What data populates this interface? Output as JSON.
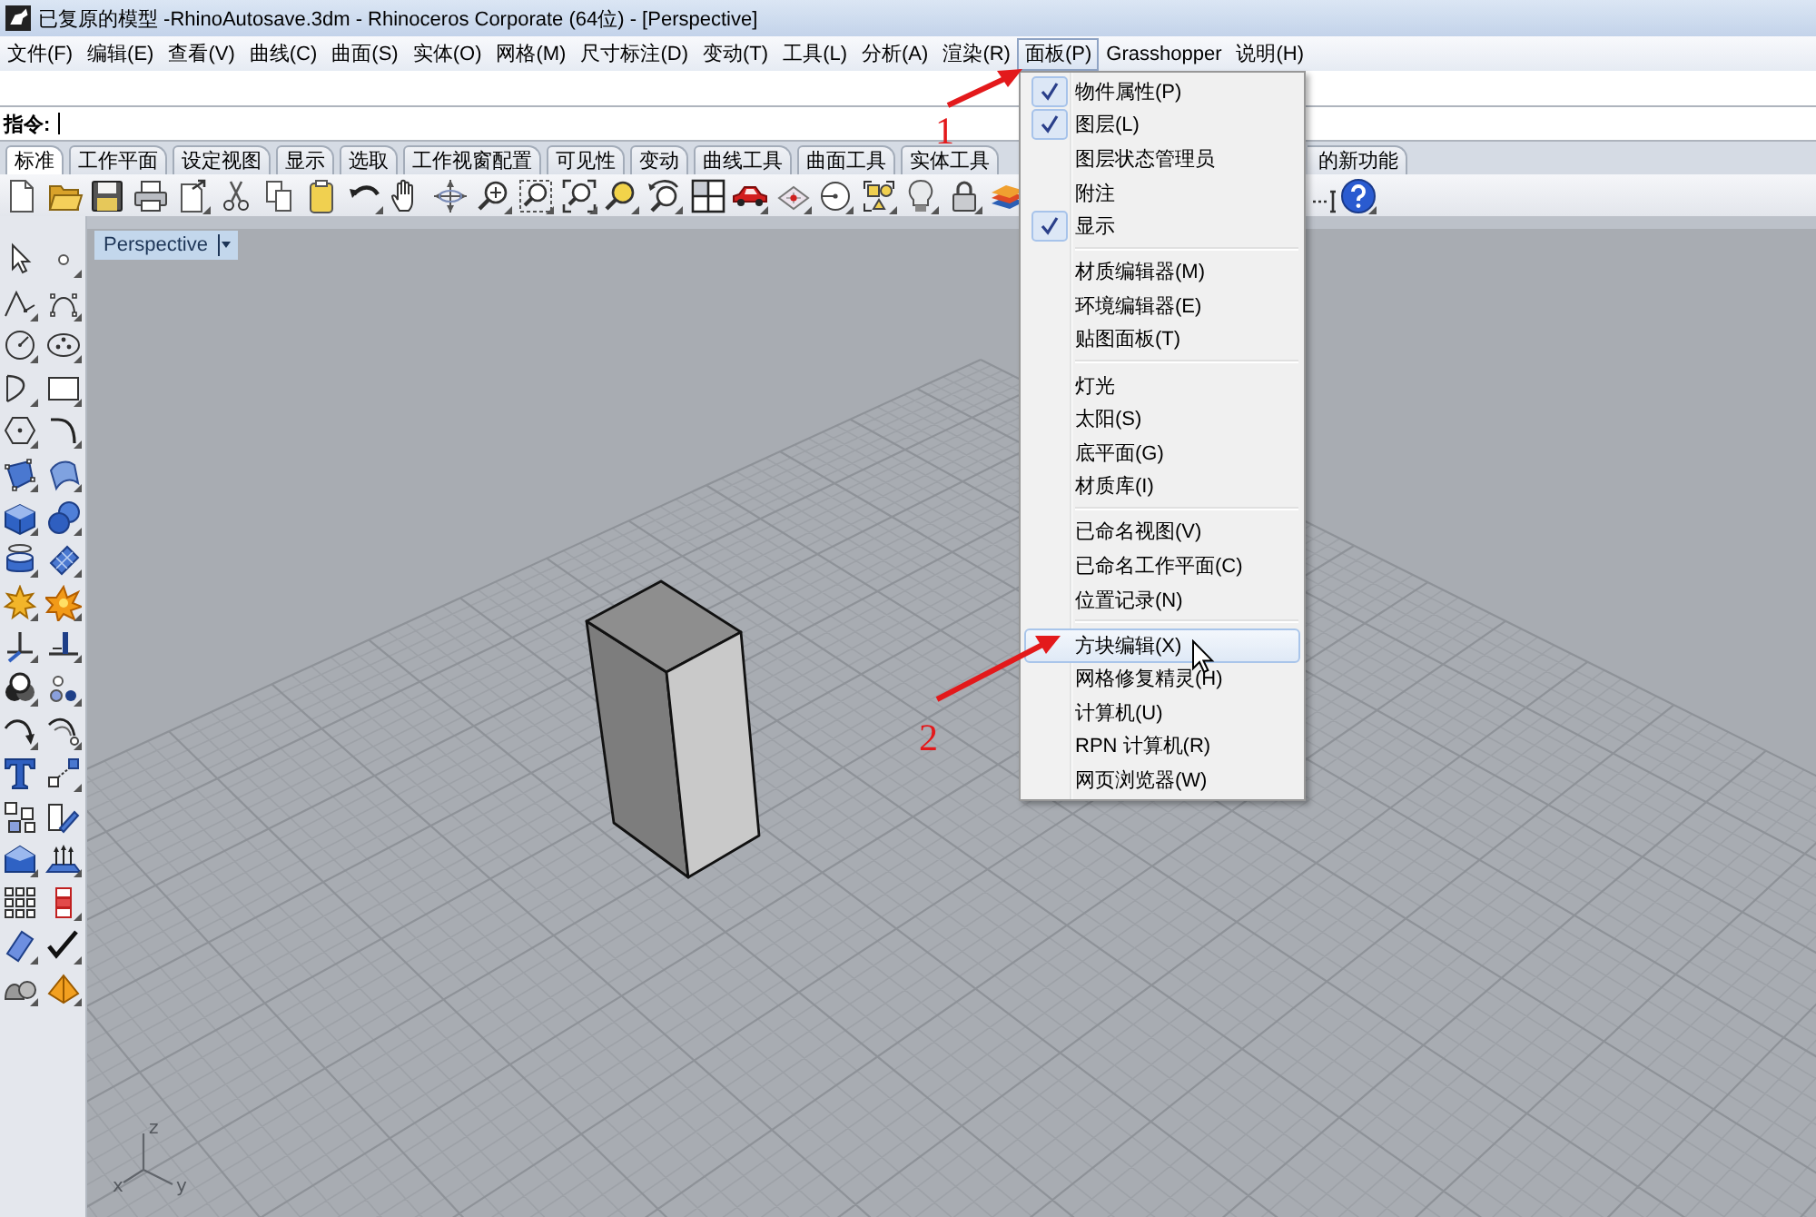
{
  "window": {
    "title": "已复原的模型 -RhinoAutosave.3dm - Rhinoceros Corporate (64位) - [Perspective]"
  },
  "menu_bar": [
    {
      "label": "文件(F)",
      "selected": false
    },
    {
      "label": "编辑(E)",
      "selected": false
    },
    {
      "label": "查看(V)",
      "selected": false
    },
    {
      "label": "曲线(C)",
      "selected": false
    },
    {
      "label": "曲面(S)",
      "selected": false
    },
    {
      "label": "实体(O)",
      "selected": false
    },
    {
      "label": "网格(M)",
      "selected": false
    },
    {
      "label": "尺寸标注(D)",
      "selected": false
    },
    {
      "label": "变动(T)",
      "selected": false
    },
    {
      "label": "工具(L)",
      "selected": false
    },
    {
      "label": "分析(A)",
      "selected": false
    },
    {
      "label": "渲染(R)",
      "selected": false
    },
    {
      "label": "面板(P)",
      "selected": true
    },
    {
      "label": "Grasshopper",
      "selected": false
    },
    {
      "label": "说明(H)",
      "selected": false
    }
  ],
  "command_line": {
    "prompt": "指令:"
  },
  "toolbar_tabs": [
    {
      "kind": "full",
      "label": "标准",
      "selected": true
    },
    {
      "kind": "full",
      "label": "工作平面",
      "selected": false
    },
    {
      "kind": "full",
      "label": "设定视图",
      "selected": false
    },
    {
      "kind": "full",
      "label": "显示",
      "selected": false
    },
    {
      "kind": "full",
      "label": "选取",
      "selected": false
    },
    {
      "kind": "full",
      "label": "工作视窗配置",
      "selected": false
    },
    {
      "kind": "full",
      "label": "可见性",
      "selected": false
    },
    {
      "kind": "full",
      "label": "变动",
      "selected": false
    },
    {
      "kind": "full",
      "label": "曲线工具",
      "selected": false
    },
    {
      "kind": "full",
      "label": "曲面工具",
      "selected": false
    },
    {
      "kind": "full",
      "label": "实体工具",
      "selected": false
    },
    {
      "kind": "partial",
      "label": "的新功能",
      "selected": false
    }
  ],
  "viewport": {
    "title": "Perspective",
    "axis_labels": [
      "z",
      "x",
      "y"
    ]
  },
  "panel_menu": {
    "items": [
      {
        "kind": "item",
        "label": "物件属性(P)",
        "checked": true,
        "selected": false
      },
      {
        "kind": "item",
        "label": "图层(L)",
        "checked": true,
        "selected": false
      },
      {
        "kind": "item",
        "label": "图层状态管理员",
        "checked": false,
        "selected": false
      },
      {
        "kind": "item",
        "label": "附注",
        "checked": false,
        "selected": false
      },
      {
        "kind": "item",
        "label": "显示",
        "checked": true,
        "selected": false
      },
      {
        "kind": "separator"
      },
      {
        "kind": "item",
        "label": "材质编辑器(M)",
        "checked": false,
        "selected": false
      },
      {
        "kind": "item",
        "label": "环境编辑器(E)",
        "checked": false,
        "selected": false
      },
      {
        "kind": "item",
        "label": "贴图面板(T)",
        "checked": false,
        "selected": false
      },
      {
        "kind": "separator"
      },
      {
        "kind": "item",
        "label": "灯光",
        "checked": false,
        "selected": false
      },
      {
        "kind": "item",
        "label": "太阳(S)",
        "checked": false,
        "selected": false
      },
      {
        "kind": "item",
        "label": "底平面(G)",
        "checked": false,
        "selected": false
      },
      {
        "kind": "item",
        "label": "材质库(I)",
        "checked": false,
        "selected": false
      },
      {
        "kind": "separator"
      },
      {
        "kind": "item",
        "label": "已命名视图(V)",
        "checked": false,
        "selected": false
      },
      {
        "kind": "item",
        "label": "已命名工作平面(C)",
        "checked": false,
        "selected": false
      },
      {
        "kind": "item",
        "label": "位置记录(N)",
        "checked": false,
        "selected": false
      },
      {
        "kind": "separator"
      },
      {
        "kind": "item",
        "label": "方块编辑(X)",
        "checked": false,
        "selected": true
      },
      {
        "kind": "item",
        "label": "网格修复精灵(H)",
        "checked": false,
        "selected": false
      },
      {
        "kind": "item",
        "label": "计算机(U)",
        "checked": false,
        "selected": false
      },
      {
        "kind": "item",
        "label": "RPN 计算机(R)",
        "checked": false,
        "selected": false
      },
      {
        "kind": "item",
        "label": "网页浏览器(W)",
        "checked": false,
        "selected": false
      }
    ]
  },
  "annotations": [
    {
      "label": "1"
    },
    {
      "label": "2"
    }
  ]
}
